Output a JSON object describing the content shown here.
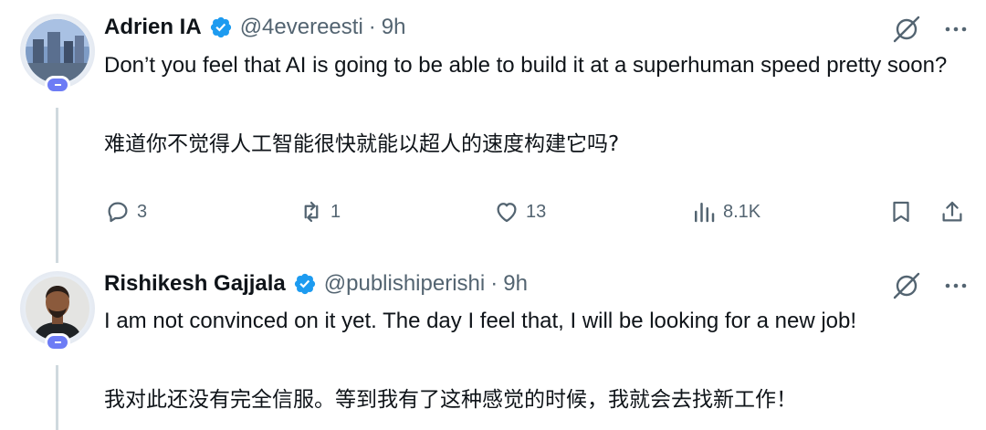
{
  "tweets": [
    {
      "author_name": "Adrien IA",
      "handle": "@4evereesti",
      "separator": "·",
      "time": "9h",
      "text_en": "Don’t you feel that AI is going to be able to build it at a superhuman speed pretty soon?",
      "text_zh": "难道你不觉得人工智能很快就能以超人的速度构建它吗?",
      "stats": {
        "replies": "3",
        "reposts": "1",
        "likes": "13",
        "views": "8.1K"
      }
    },
    {
      "author_name": "Rishikesh Gajjala",
      "handle": "@publishiperishi",
      "separator": "·",
      "time": "9h",
      "text_en": "I am not convinced on it yet. The day I feel that, I will be looking for a new job!",
      "text_zh": "我对此还没有完全信服。等到我有了这种感觉的时候，我就会去找新工作！"
    }
  ],
  "colors": {
    "verified": "#1d9bf0",
    "badge": "#6d7cf5",
    "muted": "#536471",
    "text": "#0f1419",
    "thread_line": "#cfd9de"
  },
  "icons": [
    "verified-badge-icon",
    "grok-icon",
    "more-icon",
    "reply-icon",
    "repost-icon",
    "like-icon",
    "views-icon",
    "bookmark-icon",
    "share-icon"
  ]
}
